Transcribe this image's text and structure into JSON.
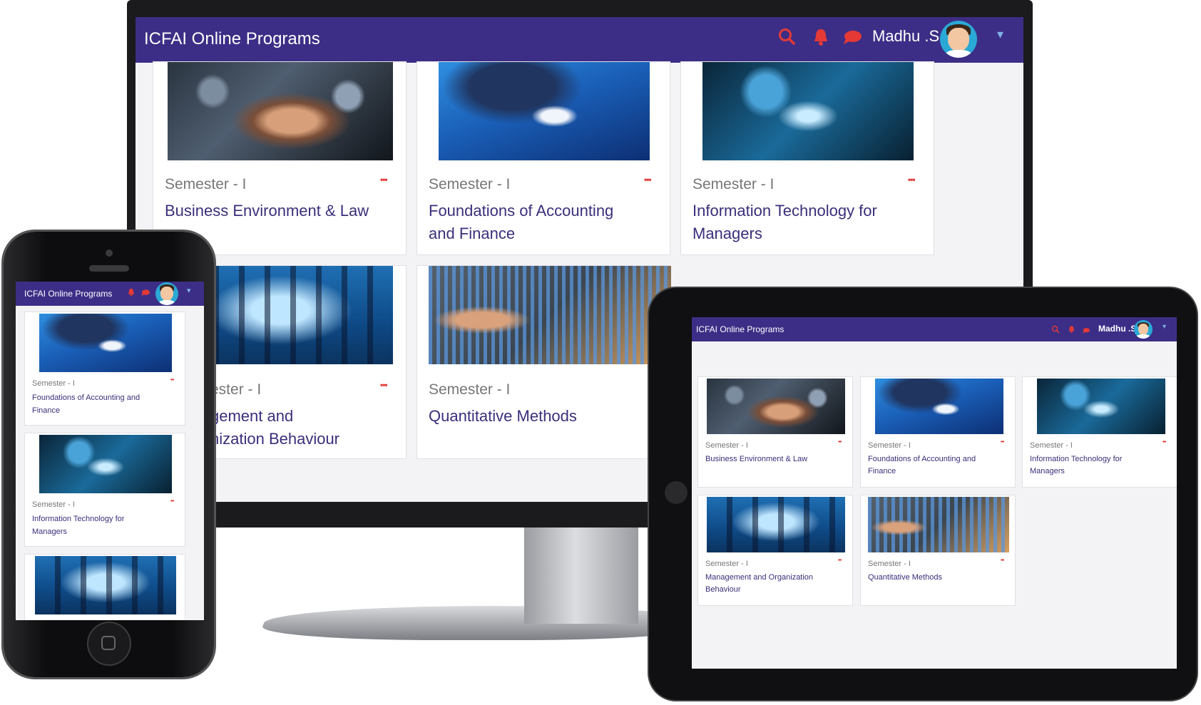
{
  "app": {
    "title": "ICFAI Online Programs",
    "user_name": "Madhu .S",
    "user_name_tablet": "Madhu .S"
  },
  "icons": {
    "search": "search-icon",
    "bell": "bell-icon",
    "chat": "chat-icon",
    "avatar": "avatar",
    "dropdown": "chevron-down-icon",
    "more": "more-dots-icon"
  },
  "colors": {
    "nav": "#3c2e86",
    "accent": "#e53935",
    "title_text": "#3a2f7a"
  },
  "courses": [
    {
      "semester": "Semester - I",
      "title": "Business Environment & Law"
    },
    {
      "semester": "Semester - I",
      "title": "Foundations of Accounting and Finance"
    },
    {
      "semester": "Semester - I",
      "title": "Information Technology for Managers"
    },
    {
      "semester": "Semester - I",
      "title": "Management and Organization Behaviour"
    },
    {
      "semester": "Semester - I",
      "title": "Quantitative Methods"
    }
  ],
  "desktop": {
    "cards": [
      {
        "semester": "Semester - I",
        "line1": "Business Environment & Law",
        "line2": ""
      },
      {
        "semester": "Semester - I",
        "line1": "Foundations of Accounting",
        "line2": "and Finance"
      },
      {
        "semester": "Semester - I",
        "line1": "Information Technology for",
        "line2": "Managers"
      },
      {
        "semester": "ester - I",
        "line1": "gement and",
        "line2": "nization Behaviour"
      },
      {
        "semester": "Semester - I",
        "line1": "Quantitative Methods",
        "line2": ""
      }
    ],
    "dots": "•••"
  },
  "phone": {
    "cards": [
      {
        "semester": "Semester - I",
        "line1": "Foundations of Accounting and",
        "line2": "Finance"
      },
      {
        "semester": "Semester - I",
        "line1": "Information Technology for",
        "line2": "Managers"
      }
    ]
  },
  "tablet": {
    "cards": [
      {
        "semester": "Semester - I",
        "line1": "Business Environment & Law",
        "line2": ""
      },
      {
        "semester": "Semester - I",
        "line1": "Foundations of Accounting and",
        "line2": "Finance"
      },
      {
        "semester": "Semester - I",
        "line1": "Information Technology for",
        "line2": "Managers"
      },
      {
        "semester": "Semester - I",
        "line1": "Management and Organization",
        "line2": "Behaviour"
      },
      {
        "semester": "Semester - I",
        "line1": "Quantitative Methods",
        "line2": ""
      }
    ]
  }
}
